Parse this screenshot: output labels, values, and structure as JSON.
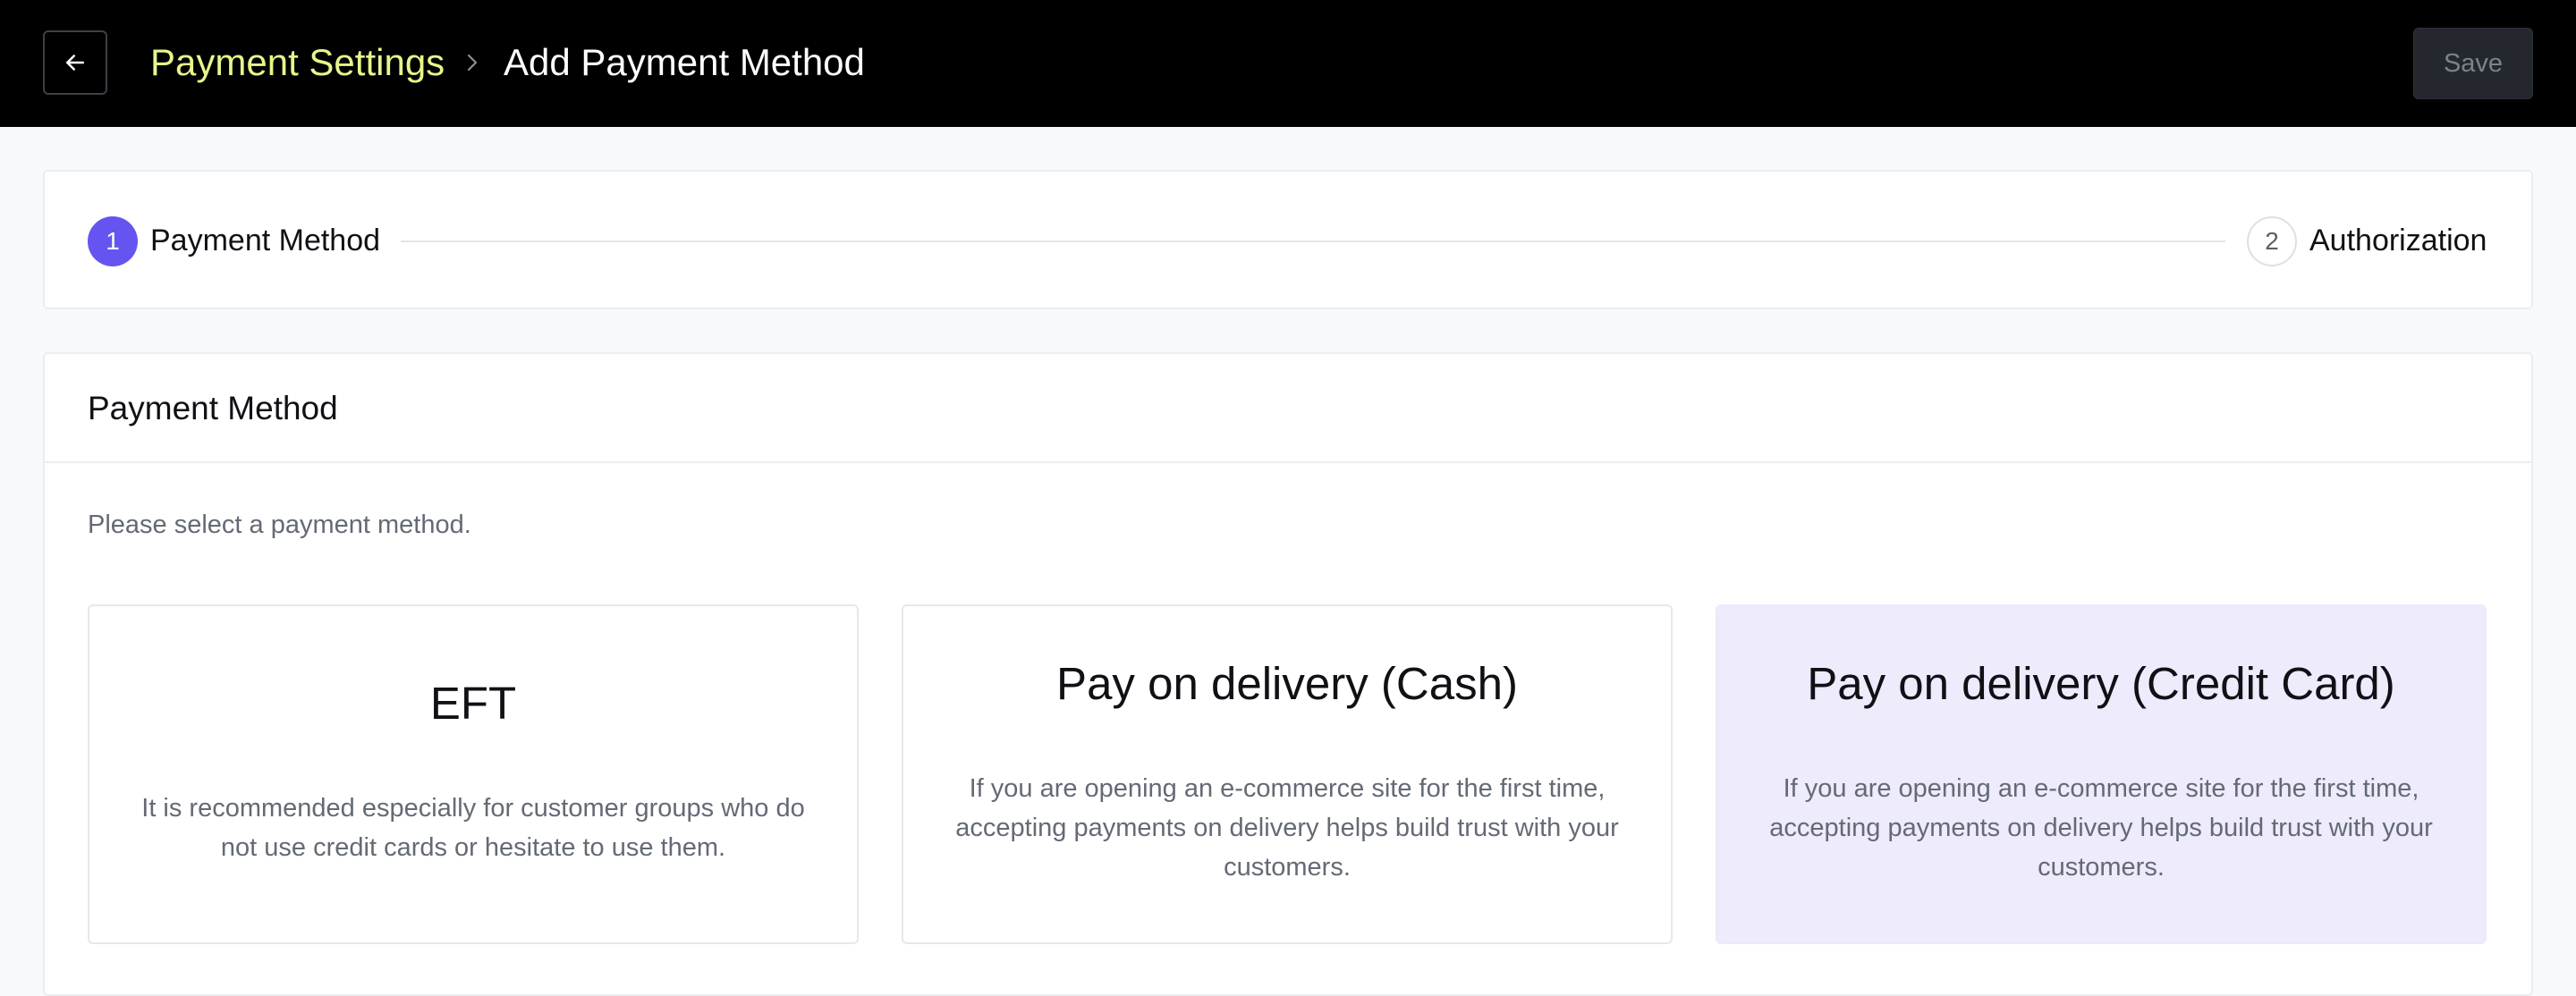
{
  "header": {
    "back_icon": "arrow-left-icon",
    "breadcrumb": {
      "parent": "Payment Settings",
      "separator_icon": "chevron-right-icon",
      "current": "Add Payment Method"
    },
    "save_label": "Save"
  },
  "stepper": {
    "steps": [
      {
        "number": "1",
        "label": "Payment Method",
        "state": "active"
      },
      {
        "number": "2",
        "label": "Authorization",
        "state": "inactive"
      }
    ]
  },
  "main": {
    "title": "Payment Method",
    "hint": "Please select a payment method.",
    "options": [
      {
        "title": "EFT",
        "description": "It is recommended especially for customer groups who do not use credit cards or hesitate to use them.",
        "selected": false
      },
      {
        "title": "Pay on delivery (Cash)",
        "description": "If you are opening an e-commerce site for the first time, accepting payments on delivery helps build trust with your customers.",
        "selected": false
      },
      {
        "title": "Pay on delivery (Credit Card)",
        "description": "If you are opening an e-commerce site for the first time, accepting payments on delivery helps build trust with your customers.",
        "selected": true
      }
    ]
  },
  "colors": {
    "topbar_bg": "#000000",
    "breadcrumb_parent": "#e9f58a",
    "accent": "#6554f0",
    "selected_option_bg": "#edebfc",
    "page_bg": "#f8f9fa"
  }
}
